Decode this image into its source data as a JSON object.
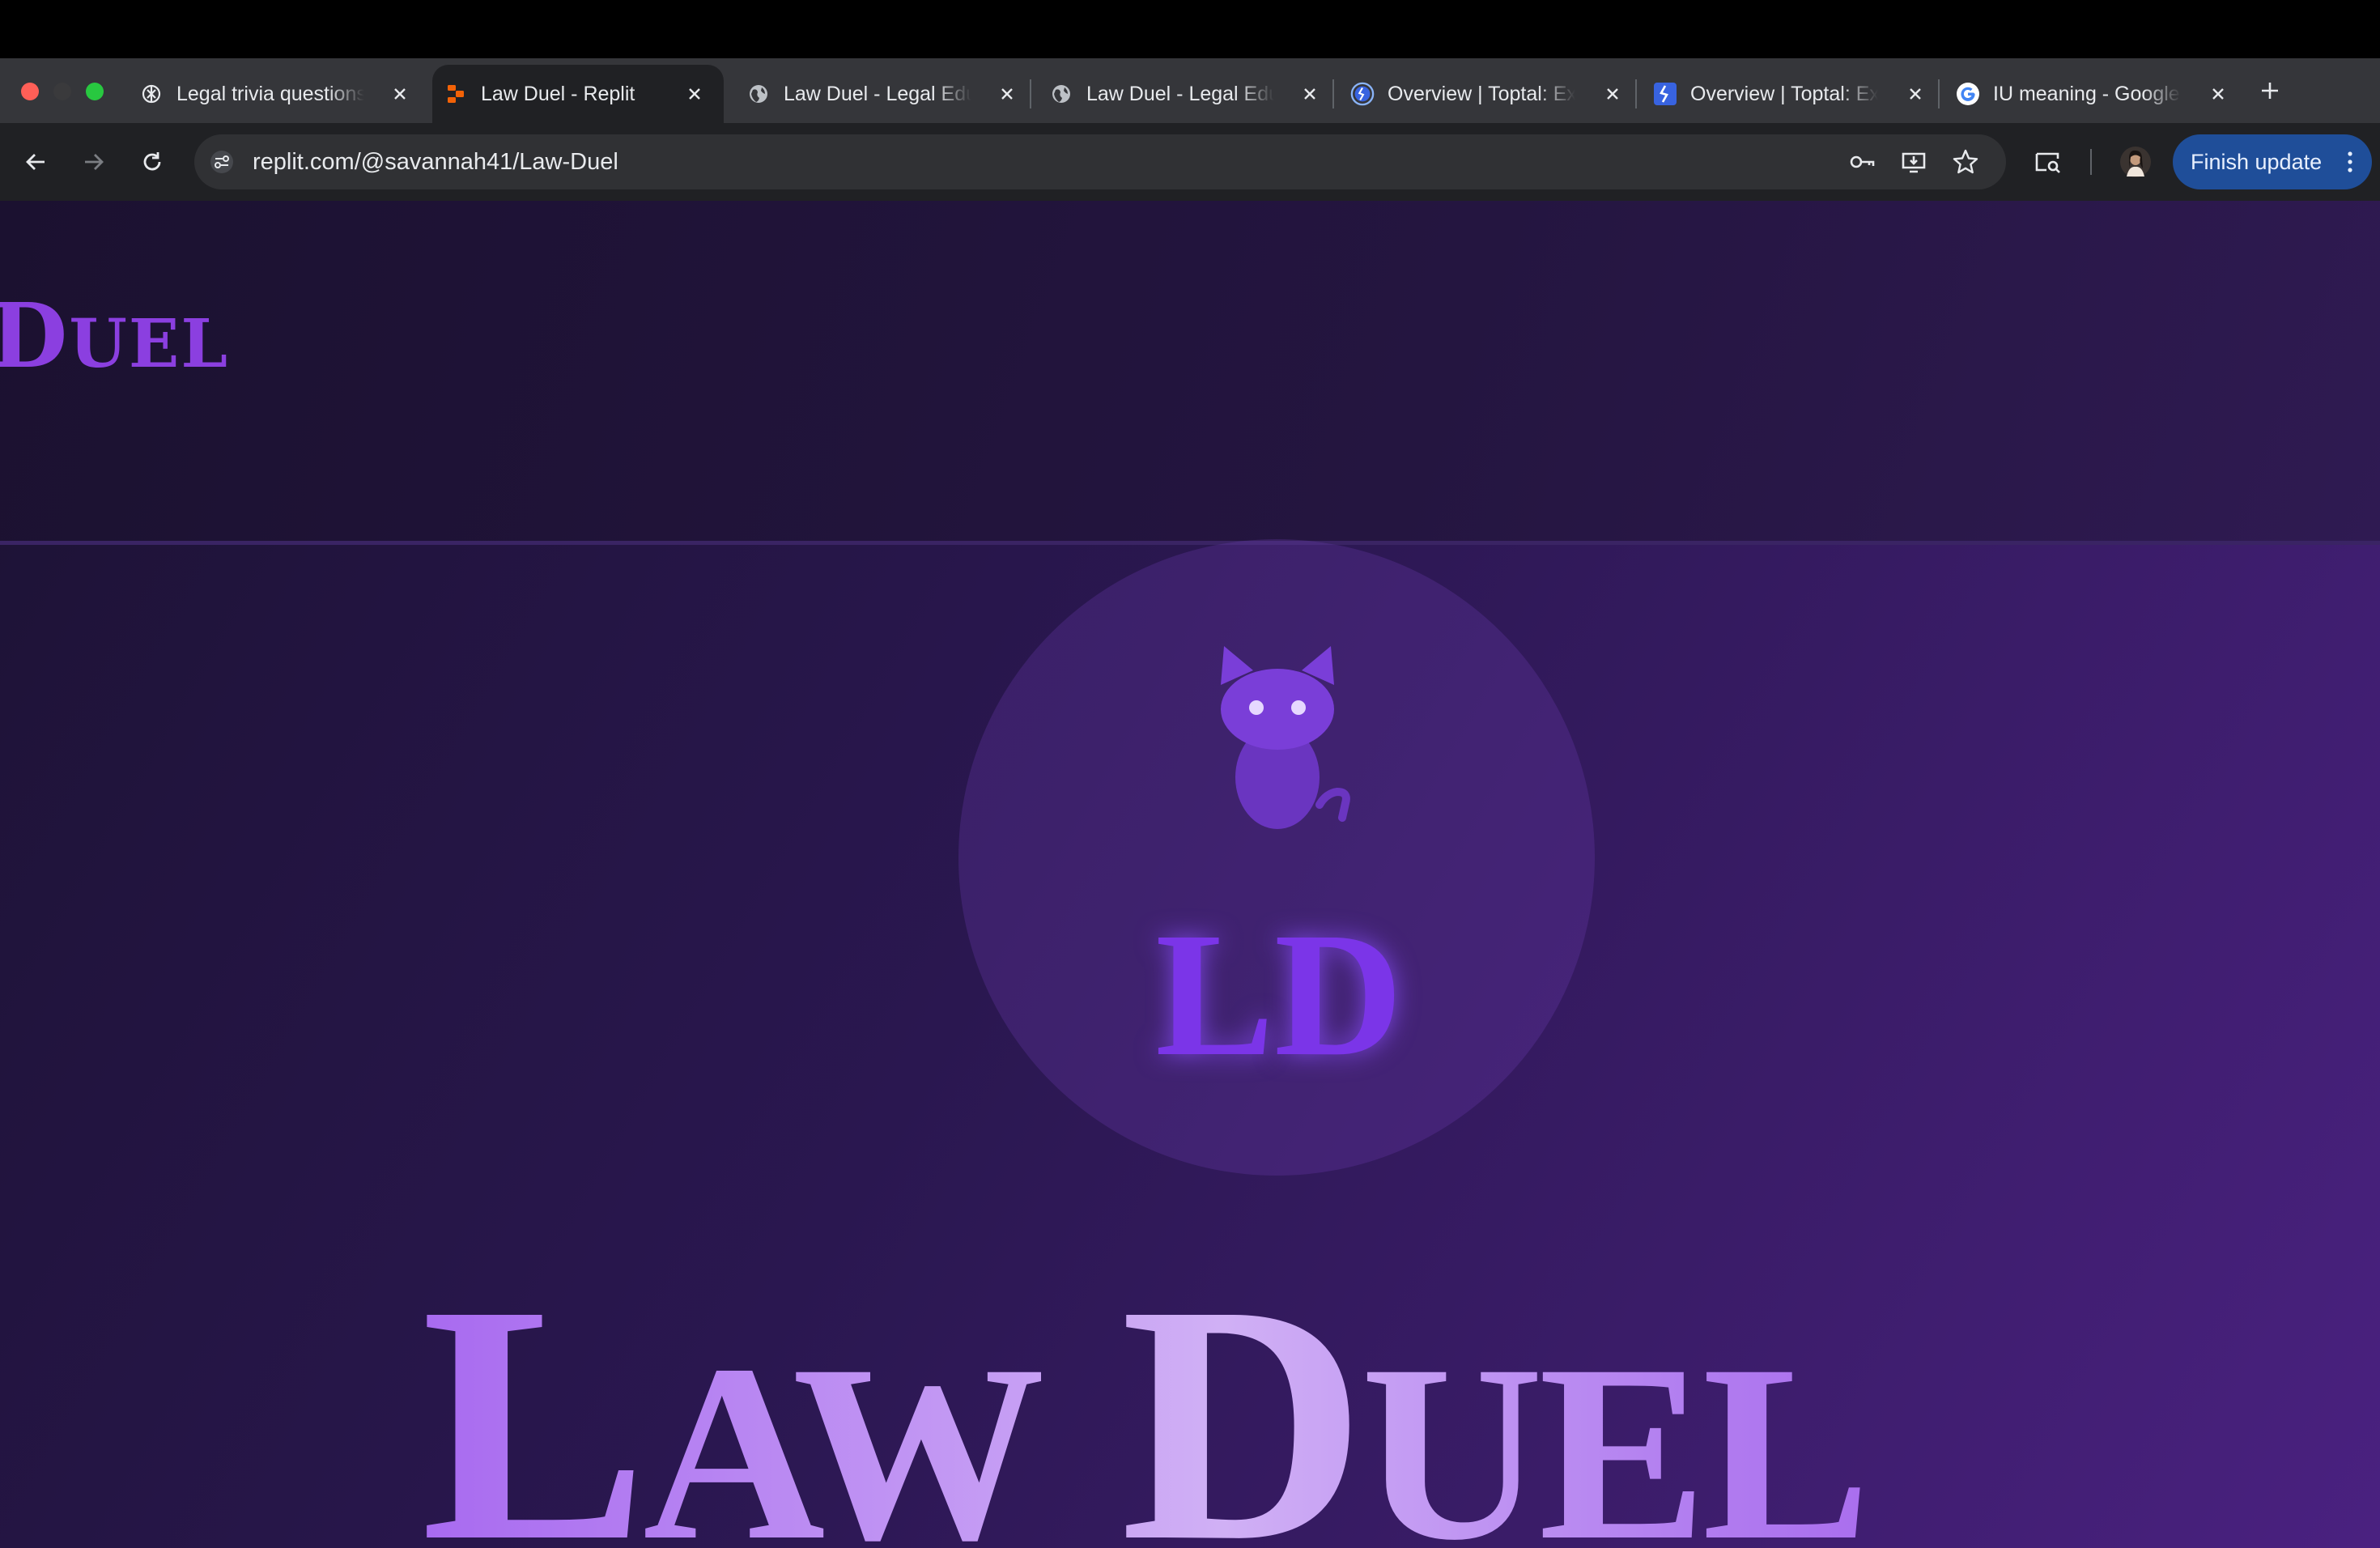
{
  "browser": {
    "tabs": [
      {
        "title": "Legal trivia questions",
        "icon": "openai-icon"
      },
      {
        "title": "Law Duel - Replit",
        "icon": "replit-icon",
        "active": true
      },
      {
        "title": "Law Duel - Legal Edu",
        "icon": "globe-icon"
      },
      {
        "title": "Law Duel - Legal Edu",
        "icon": "globe-icon"
      },
      {
        "title": "Overview | Toptal: Ex",
        "icon": "toptal-icon"
      },
      {
        "title": "Overview | Toptal: Ex",
        "icon": "toptal-icon"
      },
      {
        "title": "IU meaning - Google",
        "icon": "google-icon"
      }
    ],
    "url": "replit.com/@savannah41/Law-Duel",
    "finish_update_label": "Finish update"
  },
  "page": {
    "header_logo": {
      "first": "D",
      "rest": "UEL"
    },
    "badge_text": "LD",
    "hero_title": {
      "w1_first": "L",
      "w1_rest": "AW",
      "w2_first": "D",
      "w2_rest": "UEL"
    }
  },
  "colors": {
    "accent_purple": "#7b35e8",
    "finish_update_bg": "#1f4e99",
    "active_tab_bg": "#202124"
  }
}
